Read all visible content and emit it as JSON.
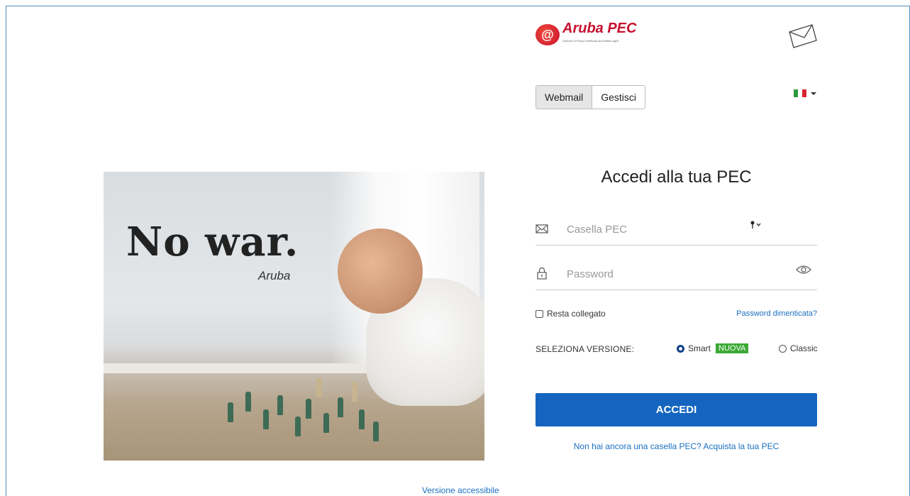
{
  "brand": {
    "name": "Aruba PEC",
    "tagline": "Gestore di Posta Certificata accreditato AgID",
    "seal": "@"
  },
  "promo": {
    "headline": "No war.",
    "subline": "Aruba"
  },
  "mode_tabs": [
    {
      "label": "Webmail",
      "active": true
    },
    {
      "label": "Gestisci",
      "active": false
    }
  ],
  "language": {
    "selected": "it"
  },
  "login": {
    "title": "Accedi alla tua PEC",
    "email_placeholder": "Casella PEC",
    "password_placeholder": "Password",
    "remember_label": "Resta collegato",
    "forgot_label": "Password dimenticata?",
    "version_label": "SELEZIONA VERSIONE:",
    "smart_label": "Smart",
    "new_badge": "NUOVA",
    "classic_label": "Classic",
    "selected_version": "Smart",
    "submit_label": "ACCEDI",
    "buy_link": "Non hai ancora una casella PEC? Acquista la tua PEC"
  },
  "footer": {
    "accessible_link": "Versione accessibile"
  },
  "colors": {
    "primary": "#1565c0",
    "link": "#1a6fc0",
    "brand_red": "#c8102e",
    "badge_green": "#3aa935"
  }
}
